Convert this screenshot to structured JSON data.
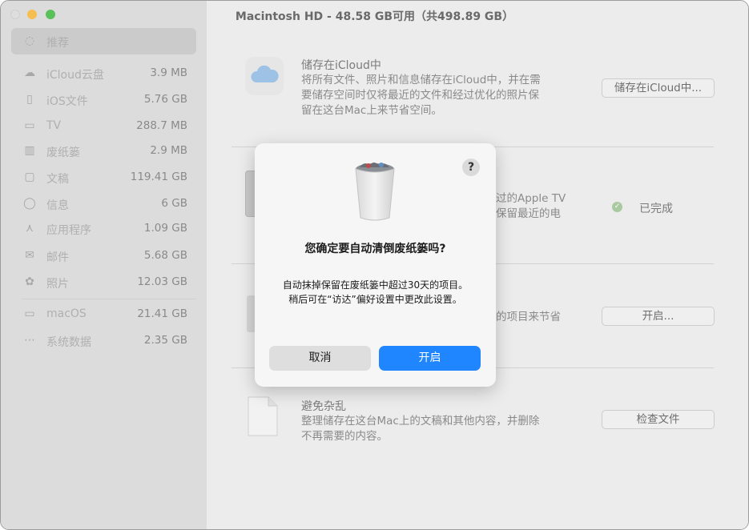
{
  "window": {
    "title": "Macintosh HD - 48.58 GB可用（共498.89 GB）"
  },
  "sidebar": {
    "items": [
      {
        "label": "推荐",
        "size": "",
        "icon": "lightbulb-icon",
        "glyph": "◌"
      },
      {
        "label": "iCloud云盘",
        "size": "3.9 MB",
        "icon": "cloud-icon",
        "glyph": "☁"
      },
      {
        "label": "iOS文件",
        "size": "5.76 GB",
        "icon": "phone-icon",
        "glyph": "▯"
      },
      {
        "label": "TV",
        "size": "288.7 MB",
        "icon": "tv-icon",
        "glyph": "▭"
      },
      {
        "label": "废纸篓",
        "size": "2.9 MB",
        "icon": "trash-icon",
        "glyph": "▥"
      },
      {
        "label": "文稿",
        "size": "119.41 GB",
        "icon": "document-icon",
        "glyph": "▢"
      },
      {
        "label": "信息",
        "size": "6 GB",
        "icon": "message-icon",
        "glyph": "◯"
      },
      {
        "label": "应用程序",
        "size": "1.09 GB",
        "icon": "apps-icon",
        "glyph": "⋏"
      },
      {
        "label": "邮件",
        "size": "5.68 GB",
        "icon": "mail-icon",
        "glyph": "✉"
      },
      {
        "label": "照片",
        "size": "12.03 GB",
        "icon": "photos-icon",
        "glyph": "✿"
      },
      {
        "label": "macOS",
        "size": "21.41 GB",
        "icon": "laptop-icon",
        "glyph": "▭"
      },
      {
        "label": "系统数据",
        "size": "2.35 GB",
        "icon": "ellipsis-icon",
        "glyph": "⋯"
      }
    ]
  },
  "main": {
    "icloud": {
      "title": "储存在iCloud中",
      "desc_lines": [
        "将所有文件、照片和信息储存在iCloud中，并在需",
        "要储存空间时仅将最近的文件和经过优化的照片保",
        "留在这台Mac上来节省空间。"
      ],
      "button": "储存在iCloud中..."
    },
    "optimize": {
      "desc_lines": [
        "过的Apple TV",
        "保留最近的电"
      ],
      "status": "已完成"
    },
    "trash": {
      "desc_partial": "的项目来节省",
      "button": "开启..."
    },
    "clutter": {
      "title": "避免杂乱",
      "desc_lines": [
        "整理储存在这台Mac上的文稿和其他内容，并删除",
        "不再需要的内容。"
      ],
      "button": "检查文件"
    }
  },
  "dialog": {
    "help": "?",
    "title": "您确定要自动清倒废纸篓吗?",
    "message_lines": [
      "自动抹掉保留在废纸篓中超过30天的项目。",
      "稍后可在“访达”偏好设置中更改此设置。"
    ],
    "cancel": "取消",
    "confirm": "开启"
  },
  "colors": {
    "accent": "#1f86ff",
    "dim_overlay": "#ececec"
  }
}
